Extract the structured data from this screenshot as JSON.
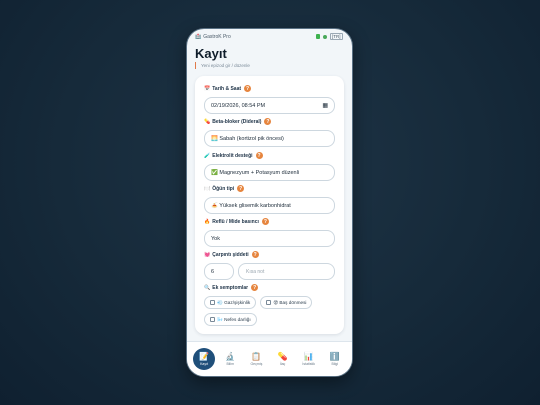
{
  "status": {
    "app_name": "GastroK Pro",
    "lang": "[TR]"
  },
  "header": {
    "title": "Kayıt",
    "subtitle": "Yeni epizod gir / düzenle"
  },
  "form": {
    "datetime": {
      "icon": "📅",
      "label": "Tarih & Saat",
      "value": "02/19/2026, 08:54 PM"
    },
    "beta_blocker": {
      "icon": "💊",
      "label": "Beta-bloker (Dideral)",
      "value": "🌅 Sabah (kortizol pik öncesi)"
    },
    "electrolyte": {
      "icon": "🧪",
      "label": "Elektrolit desteği",
      "value": "✅ Magnezyum + Potasyum düzenli"
    },
    "meal": {
      "icon": "🍽️",
      "label": "Öğün tipi",
      "value": "🍝 Yüksek glisemik karbonhidrat"
    },
    "reflux": {
      "icon": "🔥",
      "label": "Reflü / Mide basıncı",
      "value": "Yok"
    },
    "palpitation": {
      "icon": "💓",
      "label": "Çarpıntı şiddeti",
      "value": "6",
      "note_placeholder": "Kısa not"
    },
    "symptoms": {
      "icon": "🔍",
      "label": "Ek semptomlar",
      "options": [
        {
          "label": "💨 Gaz/şişkinlik"
        },
        {
          "label": "😵 Baş dönmesi"
        },
        {
          "label": "🌬️ Nefes darlığı"
        }
      ]
    }
  },
  "nav": [
    {
      "icon": "📝",
      "label": "Kayıt",
      "active": true
    },
    {
      "icon": "🔬",
      "label": "Bilim"
    },
    {
      "icon": "📋",
      "label": "Geçmiş"
    },
    {
      "icon": "💊",
      "label": "İlaç"
    },
    {
      "icon": "📊",
      "label": "İstatistik"
    },
    {
      "icon": "ℹ️",
      "label": "Bilgi"
    }
  ],
  "colors": {
    "accent": "#1f4f7a",
    "help": "#e6853e",
    "subtitle_bar": "#e07a4a"
  }
}
